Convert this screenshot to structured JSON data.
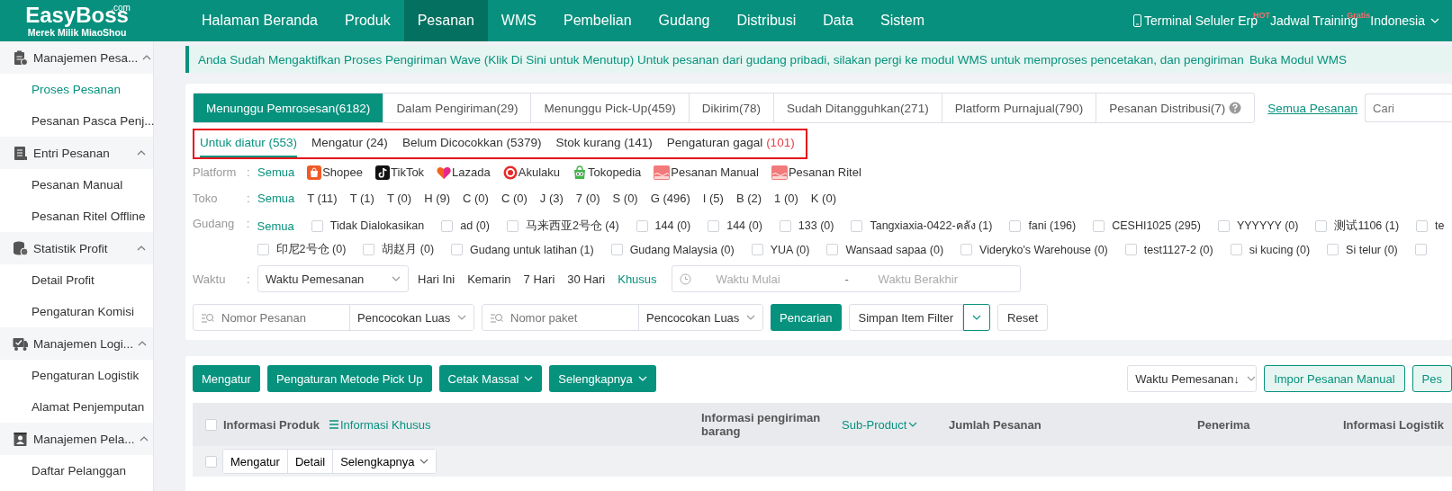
{
  "top_nav": {
    "logo": {
      "name": "EasyBoss",
      "suffix": ".com",
      "tagline": "Merek Milik MiaoShou"
    },
    "items": [
      {
        "label": "Halaman Beranda",
        "selected": false
      },
      {
        "label": "Produk",
        "selected": false
      },
      {
        "label": "Pesanan",
        "selected": true
      },
      {
        "label": "WMS",
        "selected": false
      },
      {
        "label": "Pembelian",
        "selected": false
      },
      {
        "label": "Gudang",
        "selected": false
      },
      {
        "label": "Distribusi",
        "selected": false
      },
      {
        "label": "Data",
        "selected": false
      },
      {
        "label": "Sistem",
        "selected": false
      }
    ],
    "links": [
      {
        "label": "Terminal Seluler Erp",
        "badge": "HOT",
        "kind": "phone"
      },
      {
        "label": "Jadwal Training",
        "badge": "Gratis",
        "kind": "plain"
      },
      {
        "label": "Indonesia",
        "kind": "dropdown"
      }
    ]
  },
  "sidebar": {
    "sections": [
      {
        "label": "Manajemen Pesa...",
        "expanded": true,
        "children": [
          {
            "label": "Proses Pesanan",
            "selected": true
          },
          {
            "label": "Pesanan Pasca Penj...",
            "selected": false
          }
        ]
      },
      {
        "label": "Entri Pesanan",
        "expanded": true,
        "children": [
          {
            "label": "Pesanan Manual",
            "selected": false
          },
          {
            "label": "Pesanan Ritel Offline",
            "selected": false
          }
        ]
      },
      {
        "label": "Statistik Profit",
        "expanded": true,
        "children": [
          {
            "label": "Detail Profit",
            "selected": false
          },
          {
            "label": "Pengaturan Komisi",
            "selected": false
          }
        ]
      },
      {
        "label": "Manajemen Logi...",
        "expanded": true,
        "children": [
          {
            "label": "Pengaturan Logistik",
            "selected": false
          },
          {
            "label": "Alamat Penjemputan",
            "selected": false
          }
        ]
      },
      {
        "label": "Manajemen Pela...",
        "expanded": true,
        "children": [
          {
            "label": "Daftar Pelanggan",
            "selected": false
          }
        ]
      }
    ]
  },
  "banner": {
    "text": "Anda Sudah Mengaktifkan Proses Pengiriman Wave (Klik Di Sini untuk Menutup) Untuk pesanan dari gudang pribadi, silakan pergi ke modul WMS untuk memproses pencetakan, dan pengiriman",
    "link": "Buka Modul WMS"
  },
  "status_tabs": [
    {
      "label": "Menunggu Pemrosesan(6182)",
      "selected": true,
      "help": false
    },
    {
      "label": "Dalam Pengiriman(29)",
      "selected": false,
      "help": false
    },
    {
      "label": "Menunggu Pick-Up(459)",
      "selected": false,
      "help": false
    },
    {
      "label": "Dikirim(78)",
      "selected": false,
      "help": false
    },
    {
      "label": "Sudah Ditangguhkan(271)",
      "selected": false,
      "help": false
    },
    {
      "label": "Platform Purnajual(790)",
      "selected": false,
      "help": false
    },
    {
      "label": "Pesanan Distribusi(7)",
      "selected": false,
      "help": true
    }
  ],
  "all_orders_link": "Semua Pesanan",
  "search_box": {
    "placeholder": "Cari"
  },
  "sub_tabs": [
    {
      "label": "Untuk diatur",
      "count": "(553)",
      "selected": true,
      "warning": false
    },
    {
      "label": "Mengatur",
      "count": "(24)",
      "selected": false,
      "warning": false
    },
    {
      "label": "Belum Dicocokkan",
      "count": "(5379)",
      "selected": false,
      "warning": false
    },
    {
      "label": "Stok kurang",
      "count": "(141)",
      "selected": false,
      "warning": false
    },
    {
      "label": "Pengaturan gagal",
      "count": "(101)",
      "selected": false,
      "warning": true
    }
  ],
  "filters": [
    {
      "kind": "platform",
      "label": "Platform",
      "separator": ":",
      "options": [
        {
          "label": "Semua",
          "selected": true
        },
        {
          "label": "Shopee",
          "selected": false
        },
        {
          "label": "TikTok",
          "selected": false
        },
        {
          "label": "Lazada",
          "selected": false
        },
        {
          "label": "Akulaku",
          "selected": false
        },
        {
          "label": "Tokopedia",
          "selected": false
        },
        {
          "label": "Pesanan Manual",
          "selected": false
        },
        {
          "label": "Pesanan Ritel",
          "selected": false
        }
      ]
    },
    {
      "kind": "store",
      "label": "Toko",
      "separator": ":",
      "options": [
        {
          "label": "Semua",
          "selected": true
        },
        {
          "label": "T (11)",
          "selected": false
        },
        {
          "label": "T (1)",
          "selected": false
        },
        {
          "label": "T (0)",
          "selected": false
        },
        {
          "label": "H (9)",
          "selected": false
        },
        {
          "label": "C (0)",
          "selected": false
        },
        {
          "label": "C (0)",
          "selected": false
        },
        {
          "label": "J (3)",
          "selected": false
        },
        {
          "label": "7 (0)",
          "selected": false
        },
        {
          "label": "S (0)",
          "selected": false
        },
        {
          "label": "G (496)",
          "selected": false
        },
        {
          "label": "I (5)",
          "selected": false
        },
        {
          "label": "B (2)",
          "selected": false
        },
        {
          "label": "1 (0)",
          "selected": false
        },
        {
          "label": "K (0)",
          "selected": false
        }
      ]
    },
    {
      "kind": "warehouse",
      "label": "Gudang",
      "separator": ":",
      "all": {
        "label": "Semua",
        "selected": true
      },
      "options": [
        {
          "label": "Tidak Dialokasikan",
          "checked": false
        },
        {
          "label": "ad (0)",
          "checked": false
        },
        {
          "label": "马来西亚2号仓 (4)",
          "checked": false
        },
        {
          "label": "144 (0)",
          "checked": false
        },
        {
          "label": "144 (0)",
          "checked": false
        },
        {
          "label": "133 (0)",
          "checked": false
        },
        {
          "label": "Tangxiaxia-0422-คลัง (1)",
          "checked": false
        },
        {
          "label": "fani (196)",
          "checked": false
        },
        {
          "label": "CESHI1025 (295)",
          "checked": false
        },
        {
          "label": "YYYYYY (0)",
          "checked": false
        },
        {
          "label": "测试1106 (1)",
          "checked": false
        },
        {
          "label": "te",
          "checked": false
        },
        {
          "label": "印尼2号仓 (0)",
          "checked": false
        },
        {
          "label": "胡赵月 (0)",
          "checked": false
        },
        {
          "label": "Gudang untuk latihan (1)",
          "checked": false
        },
        {
          "label": "Gudang Malaysia (0)",
          "checked": false
        },
        {
          "label": "YUA (0)",
          "checked": false
        },
        {
          "label": "Wansaad sapaa (0)",
          "checked": false
        },
        {
          "label": "Videryko's Warehouse (0)",
          "checked": false
        },
        {
          "label": "test1127-2 (0)",
          "checked": false
        },
        {
          "label": "si kucing (0)",
          "checked": false
        },
        {
          "label": "Si telur (0)",
          "checked": false
        },
        {
          "checked": false
        }
      ]
    },
    {
      "kind": "time",
      "label": "Waktu",
      "separator": ":",
      "select": "Waktu Pemesanan",
      "options": [
        {
          "label": "Hari Ini",
          "selected": false
        },
        {
          "label": "Kemarin",
          "selected": false
        },
        {
          "label": "7 Hari",
          "selected": false
        },
        {
          "label": "30 Hari",
          "selected": false
        },
        {
          "label": "Khusus",
          "selected": true
        }
      ],
      "range": {
        "start_placeholder": "Waktu Mulai",
        "separator": "-",
        "end_placeholder": "Waktu Berakhir"
      }
    }
  ],
  "search_row": {
    "fields": [
      {
        "placeholder": "Nomor Pesanan",
        "match": "Pencocokan Luas"
      },
      {
        "placeholder": "Nomor paket",
        "match": "Pencocokan Luas"
      }
    ],
    "search_button": "Pencarian",
    "save_filter": "Simpan Item Filter",
    "reset": "Reset"
  },
  "actions": {
    "buttons": [
      {
        "label": "Mengatur",
        "dropdown": false
      },
      {
        "label": "Pengaturan Metode Pick Up",
        "dropdown": false
      },
      {
        "label": "Cetak Massal",
        "dropdown": true
      },
      {
        "label": "Selengkapnya",
        "dropdown": true
      }
    ],
    "sort": "Waktu Pemesanan↓",
    "right_buttons": [
      "Impor Pesanan Manual",
      "Pes"
    ]
  },
  "table": {
    "header_checkbox": {
      "checked": false
    },
    "columns": [
      {
        "label": "Informasi Produk",
        "kind": "checkbox"
      },
      {
        "label": "Informasi Khusus",
        "kind": "link"
      },
      {
        "label": "Informasi pengiriman barang",
        "kind": "plain"
      },
      {
        "label": "Sub-Product",
        "kind": "dropdown"
      },
      {
        "label": "Jumlah Pesanan",
        "kind": "plain"
      },
      {
        "label": "Penerima",
        "kind": "plain"
      },
      {
        "label": "Informasi Logistik",
        "kind": "plain"
      }
    ],
    "bulk_row": {
      "checked": false,
      "buttons": [
        {
          "label": "Mengatur",
          "dropdown": false
        },
        {
          "label": "Detail",
          "dropdown": false
        },
        {
          "label": "Selengkapnya",
          "dropdown": true
        }
      ]
    }
  }
}
